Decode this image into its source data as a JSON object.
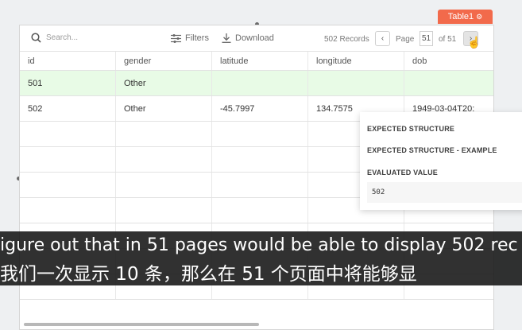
{
  "widget": {
    "name": "Table1",
    "icon": "gear-icon"
  },
  "toolbar": {
    "search_placeholder": "Search...",
    "filters_label": "Filters",
    "download_label": "Download",
    "records_label": "502 Records",
    "page_label": "Page",
    "page_value": "51",
    "page_of": "of 51"
  },
  "table": {
    "columns": [
      "id",
      "gender",
      "latitude",
      "longitude",
      "dob"
    ],
    "rows": [
      [
        "501",
        "Other",
        "",
        "",
        ""
      ],
      [
        "502",
        "Other",
        "-45.7997",
        "134.7575",
        "1949-03-04T20:"
      ]
    ]
  },
  "popover": {
    "expected_structure": "EXPECTED STRUCTURE",
    "expected_example": "EXPECTED STRUCTURE - EXAMPLE",
    "evaluated_value_label": "EVALUATED VALUE",
    "evaluated_value": "502"
  },
  "subtitles": {
    "english": "igure out that in 51 pages would be able to display 502 rec",
    "chinese": "我们一次显示 10 条，那么在 51 个页面中将能够显"
  },
  "colors": {
    "badge": "#f26a4b",
    "row_highlight": "#e8fbe6"
  }
}
